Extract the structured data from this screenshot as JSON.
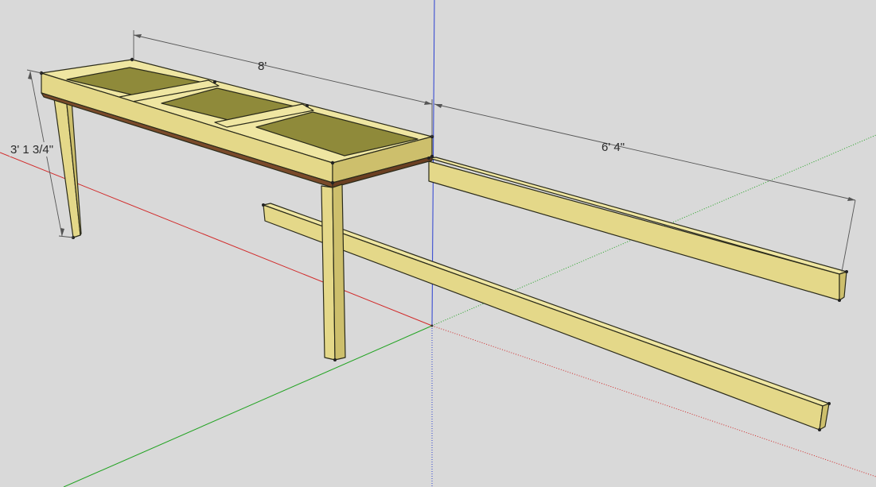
{
  "dimensions": {
    "length_label": "8'",
    "height_label": "3' 1 3/4\"",
    "span_label": "6' 4\""
  },
  "colors": {
    "background": "#d9d9d9",
    "x_axis": "#d12a2a",
    "y_axis": "#22a322",
    "z_axis": "#2a3fd1",
    "wood": "#e8dd93",
    "panel": "#8f8a3a"
  },
  "icons": [
    "axis-origin"
  ]
}
